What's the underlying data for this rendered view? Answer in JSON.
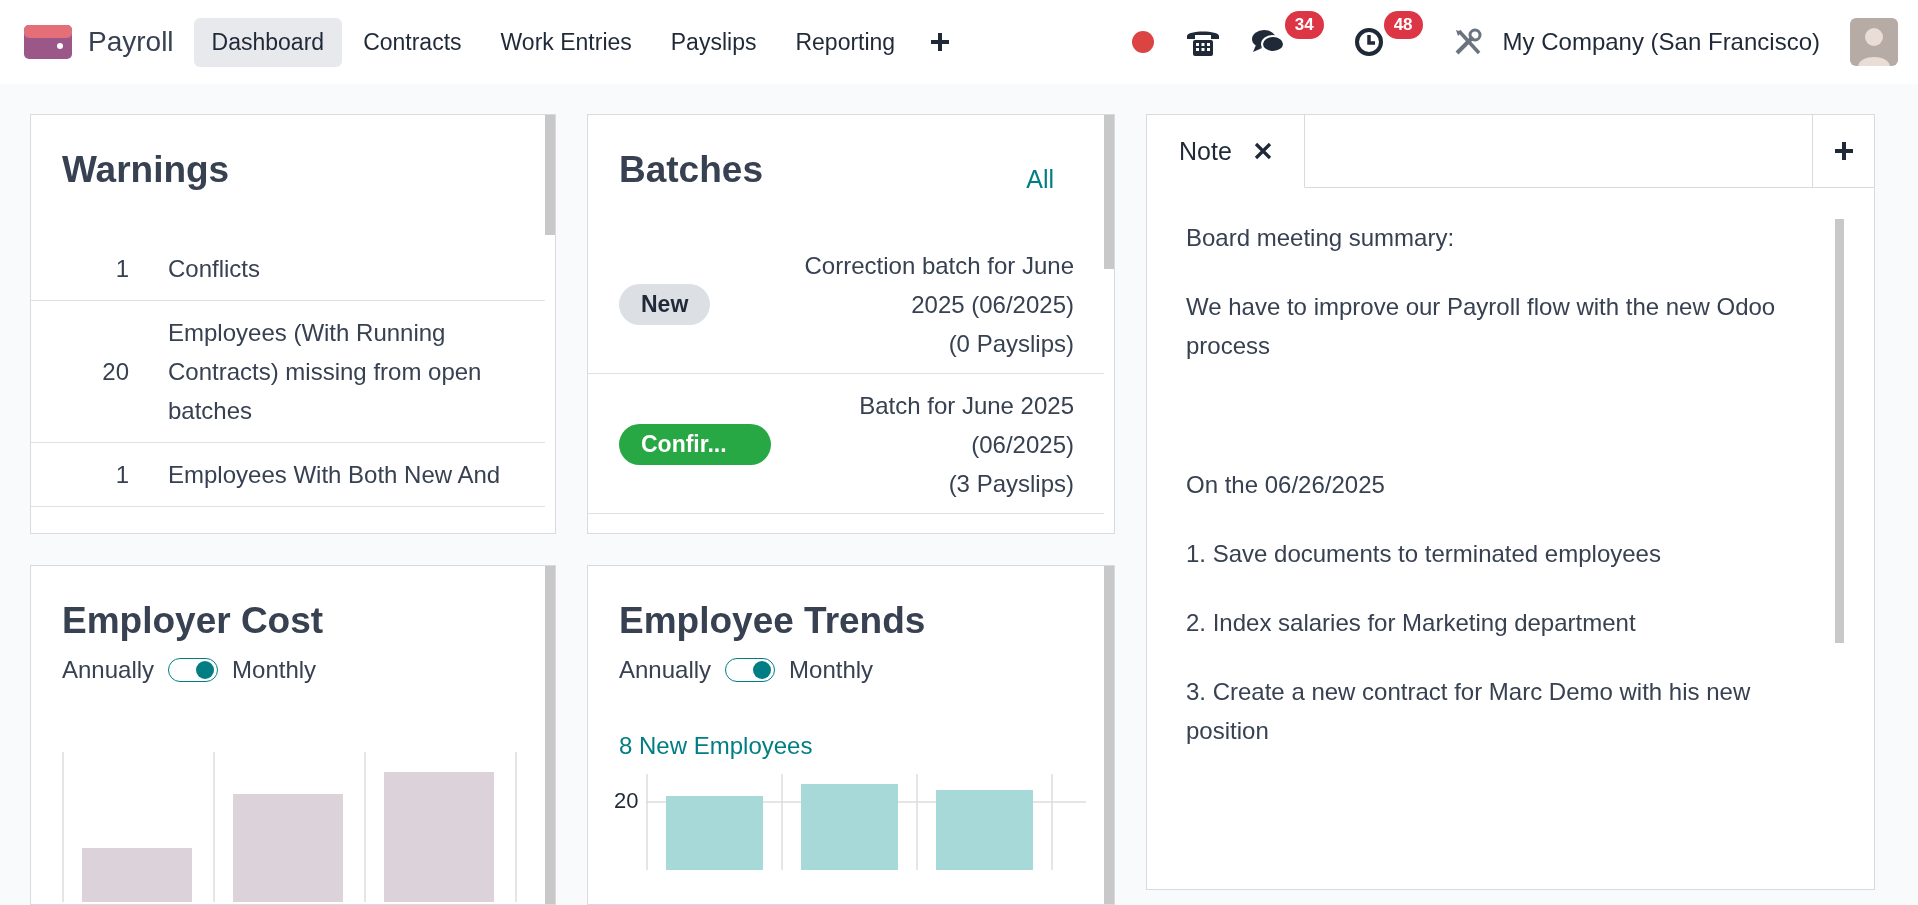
{
  "navbar": {
    "app_name": "Payroll",
    "menu": [
      {
        "label": "Dashboard",
        "selected": true
      },
      {
        "label": "Contracts",
        "selected": false
      },
      {
        "label": "Work Entries",
        "selected": false
      },
      {
        "label": "Payslips",
        "selected": false
      },
      {
        "label": "Reporting",
        "selected": false
      }
    ],
    "chat_badge": "34",
    "activity_badge": "48",
    "company": "My Company (San Francisco)"
  },
  "warnings": {
    "title": "Warnings",
    "items": [
      {
        "count": "1",
        "label": "Conflicts"
      },
      {
        "count": "20",
        "label": "Employees (With Running Contracts) missing from open batches"
      },
      {
        "count": "1",
        "label": "Employees With Both New And"
      }
    ]
  },
  "batches": {
    "title": "Batches",
    "link": "All",
    "items": [
      {
        "kind": "draft",
        "state": "New",
        "name": "Correction batch for June 2025 (06/2025)",
        "payslips": "(0 Payslips)"
      },
      {
        "kind": "confirmed",
        "state": "Confir...",
        "name": "Batch for June 2025 (06/2025)",
        "payslips": "(3 Payslips)"
      }
    ]
  },
  "employer_cost": {
    "title": "Employer Cost",
    "toggle": {
      "left": "Annually",
      "right": "Monthly",
      "on": true
    }
  },
  "employee_trends": {
    "title": "Employee Trends",
    "toggle": {
      "left": "Annually",
      "right": "Monthly",
      "on": true
    },
    "link": "8 New Employees",
    "y_tick": "20"
  },
  "note": {
    "tabs": [
      {
        "label": "Note",
        "selected": true
      }
    ],
    "paragraphs": [
      "Board meeting summary:",
      "We have to improve our Payroll flow with the new Odoo process",
      "On the 06/26/2025",
      "1. Save documents to terminated employees",
      "2. Index salaries for Marketing department",
      "3. Create a new contract for Marc Demo with his new position"
    ]
  }
}
